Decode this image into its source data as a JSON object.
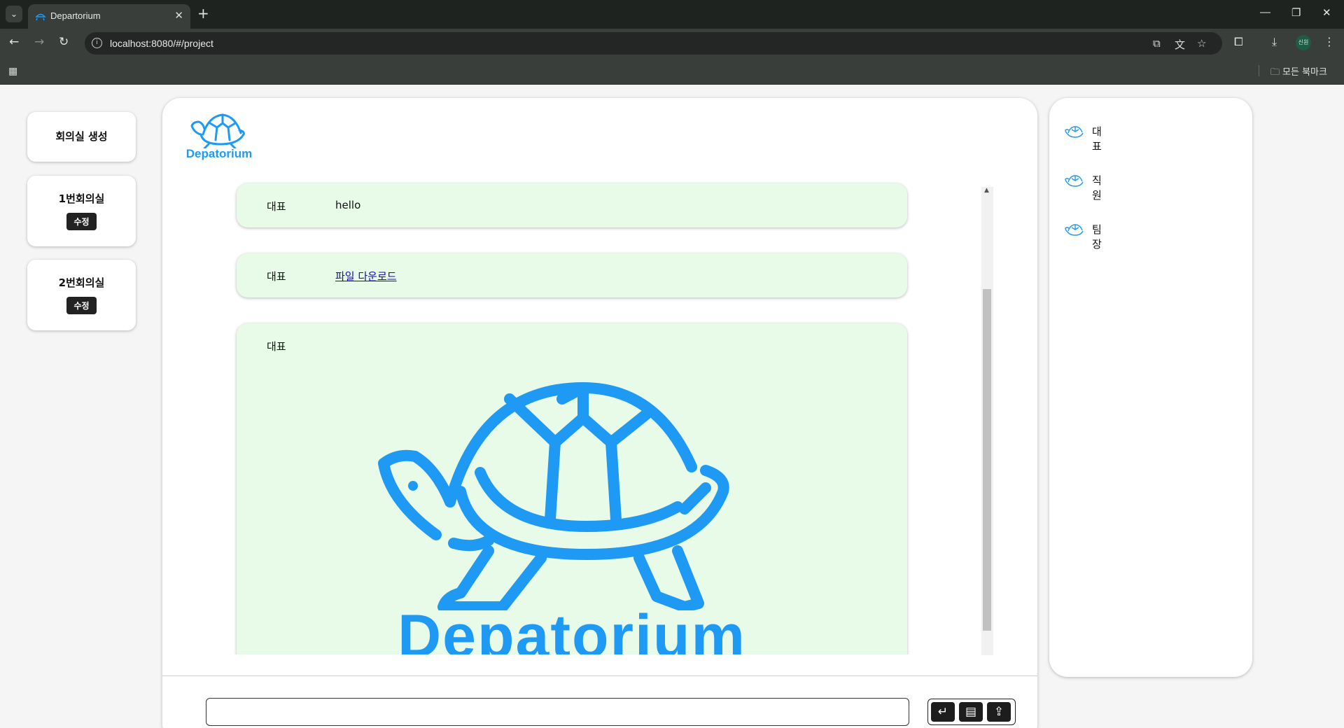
{
  "browser": {
    "tab_title": "Departorium",
    "url": "localhost:8080/#/project",
    "bookmarks_all": "모든 북마크",
    "profile_initials": "신원",
    "icons": [
      "tab-list-icon",
      "close-icon",
      "plus-icon",
      "minimize-icon",
      "restore-icon",
      "back-icon",
      "forward-icon",
      "reload-icon",
      "info-icon",
      "install-icon",
      "translate-icon",
      "star-icon",
      "extensions-icon",
      "download-icon",
      "menu-icon",
      "apps-icon",
      "folder-icon"
    ]
  },
  "rooms": {
    "create_label": "회의실 생성",
    "items": [
      {
        "title": "1번회의실",
        "edit_label": "수정"
      },
      {
        "title": "2번회의실",
        "edit_label": "수정"
      }
    ]
  },
  "logo": {
    "text": "Depatorium",
    "color": "#1e9af5"
  },
  "messages": [
    {
      "sender": "대표",
      "text": "hello"
    },
    {
      "sender": "대표",
      "link": "파일 다운로드"
    },
    {
      "sender": "대표",
      "image_text": "Depatorium"
    }
  ],
  "composer": {
    "input_value": "",
    "buttons": [
      "enter-icon",
      "calendar-icon",
      "upload-icon"
    ]
  },
  "members": [
    {
      "name": "대표"
    },
    {
      "name": "직원"
    },
    {
      "name": "팀장"
    }
  ],
  "colors": {
    "accent": "#1e9af5",
    "message_bg": "#e8fbe8",
    "page_bg": "#f5f5f5",
    "chrome_dark": "#1f2320",
    "chrome_toolbar": "#3a3e3a"
  }
}
